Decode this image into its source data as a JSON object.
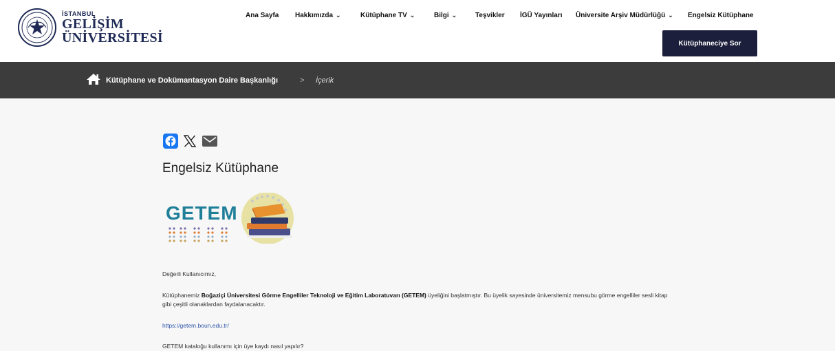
{
  "logo": {
    "small": "İSTANBUL",
    "line1": "GELİŞİM",
    "line2": "ÜNİVERSİTESİ"
  },
  "nav": {
    "items": [
      {
        "label": "Ana Sayfa",
        "dropdown": false
      },
      {
        "label": "Hakkımızda",
        "dropdown": true
      },
      {
        "label": "Kütüphane TV",
        "dropdown": true
      },
      {
        "label": "Bilgi",
        "dropdown": true
      },
      {
        "label": "Teşvikler",
        "dropdown": false
      },
      {
        "label": "İGÜ Yayınları",
        "dropdown": false
      },
      {
        "label": "Üniversite Arşiv Müdürlüğü",
        "dropdown": true
      },
      {
        "label": "Engelsiz Kütüphane",
        "dropdown": false
      }
    ],
    "ask_button": "Kütüphaneciye Sor"
  },
  "breadcrumb": {
    "home_label": "Kütüphane ve Dokümantasyon Daire Başkanlığı",
    "separator": ">",
    "current": "İçerik"
  },
  "content": {
    "share_icons": [
      "facebook-icon",
      "x-icon",
      "mail-icon"
    ],
    "title": "Engelsiz Kütüphane",
    "logo_text": "GETEM",
    "greeting": "Değerli Kullanıcımız,",
    "para_before": "Kütüphanemiz ",
    "para_bold": "Boğaziçi Üniversitesi Görme Engelliler Teknoloji ve Eğitim Laboratuvarı (GETEM)",
    "para_after": " üyeliğini başlatmıştır. Bu üyelik sayesinde üniversitemiz mensubu görme engelliler sesli kitap gibi çeşitli olanaklardan faydalanacaktır.",
    "link": "https://getem.boun.edu.tr/",
    "question": "GETEM kataloğu kullanımı için üye kaydı nasıl yapılır?"
  },
  "colors": {
    "navy": "#1b1f3b",
    "breadcrumb_bg": "#3c3c3c",
    "content_bg": "#f7f7f7",
    "link": "#2e56a8",
    "getem_teal": "#1f7f99"
  }
}
